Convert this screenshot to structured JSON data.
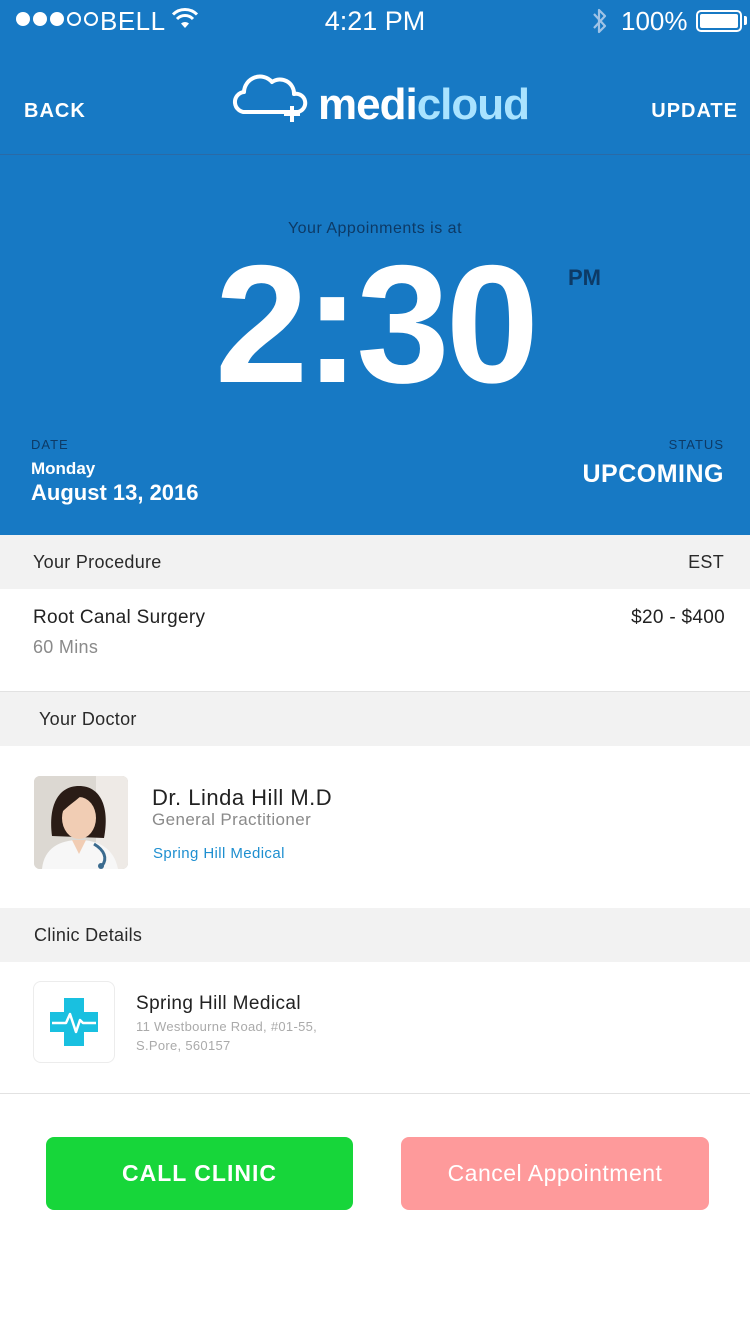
{
  "status_bar": {
    "carrier": "BELL",
    "time": "4:21 PM",
    "battery": "100%"
  },
  "nav": {
    "back_label": "BACK",
    "update_label": "UPDATE",
    "logo_part1": "medi",
    "logo_part2": "cloud"
  },
  "appointment": {
    "label": "Your Appoinments is at",
    "time": "2:30",
    "ampm": "PM",
    "date_label": "DATE",
    "day": "Monday",
    "date": "August 13, 2016",
    "status_label": "STATUS",
    "status": "UPCOMING"
  },
  "procedure": {
    "section_title": "Your Procedure",
    "est_label": "EST",
    "name": "Root Canal Surgery",
    "duration": "60 Mins",
    "price": "$20 - $400"
  },
  "doctor": {
    "section_title": "Your Doctor",
    "name": "Dr. Linda Hill  M.D",
    "title": "General Practitioner",
    "clinic": "Spring Hill Medical"
  },
  "clinic": {
    "section_title": "Clinic Details",
    "name": "Spring Hill Medical",
    "address_line1": "11 Westbourne Road, #01-55,",
    "address_line2": "S.Pore, 560157"
  },
  "actions": {
    "call_label": "CALL CLINIC",
    "cancel_label": "Cancel Appointment"
  },
  "colors": {
    "primary": "#1779c4",
    "call": "#17d63a",
    "cancel": "#fe9a9b",
    "link": "#1e8fd0"
  }
}
